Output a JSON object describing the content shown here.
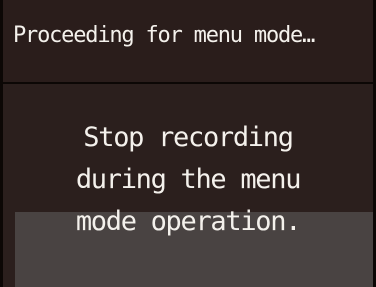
{
  "screen": {
    "header_text": "Proceeding for menu mode…",
    "message_lines": [
      "Stop recording",
      "during the menu",
      "mode operation."
    ]
  }
}
